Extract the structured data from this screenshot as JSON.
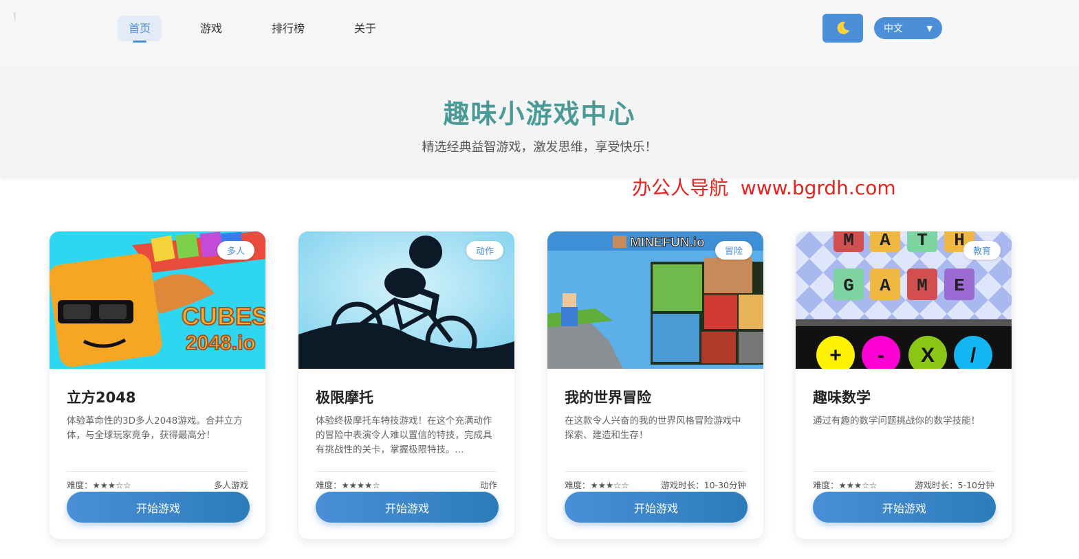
{
  "header": {
    "nav": [
      {
        "label": "首页"
      },
      {
        "label": "游戏"
      },
      {
        "label": "排行榜"
      },
      {
        "label": "关于"
      }
    ],
    "theme_icon": "moon-icon",
    "language": "中文",
    "accent_color": "#4a8fd8"
  },
  "hero": {
    "title": "趣味小游戏中心",
    "subtitle": "精选经典益智游戏，激发思维，享受快乐！"
  },
  "watermark": "办公人导航  www.bgrdh.com",
  "cards": [
    {
      "badge": "多人",
      "title": "立方2048",
      "desc": "体验革命性的3D多人2048游戏。合并立方体，与全球玩家竞争，获得最高分！",
      "difficulty": "难度：★★★☆☆",
      "meta": "多人游戏",
      "button": "开始游戏",
      "thumb_text": "CUBES 2048.io"
    },
    {
      "badge": "动作",
      "title": "极限摩托",
      "desc": "体验终极摩托车特技游戏！在这个充满动作的冒险中表演令人难以置信的特技，完成具有挑战性的关卡，掌握极限特技。...",
      "difficulty": "难度：★★★★☆",
      "meta": "动作",
      "button": "开始游戏"
    },
    {
      "badge": "冒险",
      "title": "我的世界冒险",
      "desc": "在这款令人兴奋的我的世界风格冒险游戏中探索、建造和生存！",
      "difficulty": "难度：★★★☆☆",
      "meta": "游戏时长：10-30分钟",
      "button": "开始游戏",
      "thumb_text": "MINEFUN.io"
    },
    {
      "badge": "教育",
      "title": "趣味数学",
      "desc": "通过有趣的数学问题挑战你的数学技能！",
      "difficulty": "难度：★★★☆☆",
      "meta": "游戏时长：5-10分钟",
      "button": "开始游戏",
      "thumb_letters": [
        "M",
        "A",
        "T",
        "H",
        "G",
        "A",
        "M",
        "E"
      ],
      "thumb_ops": [
        "+",
        "-",
        "X",
        "/"
      ]
    }
  ]
}
